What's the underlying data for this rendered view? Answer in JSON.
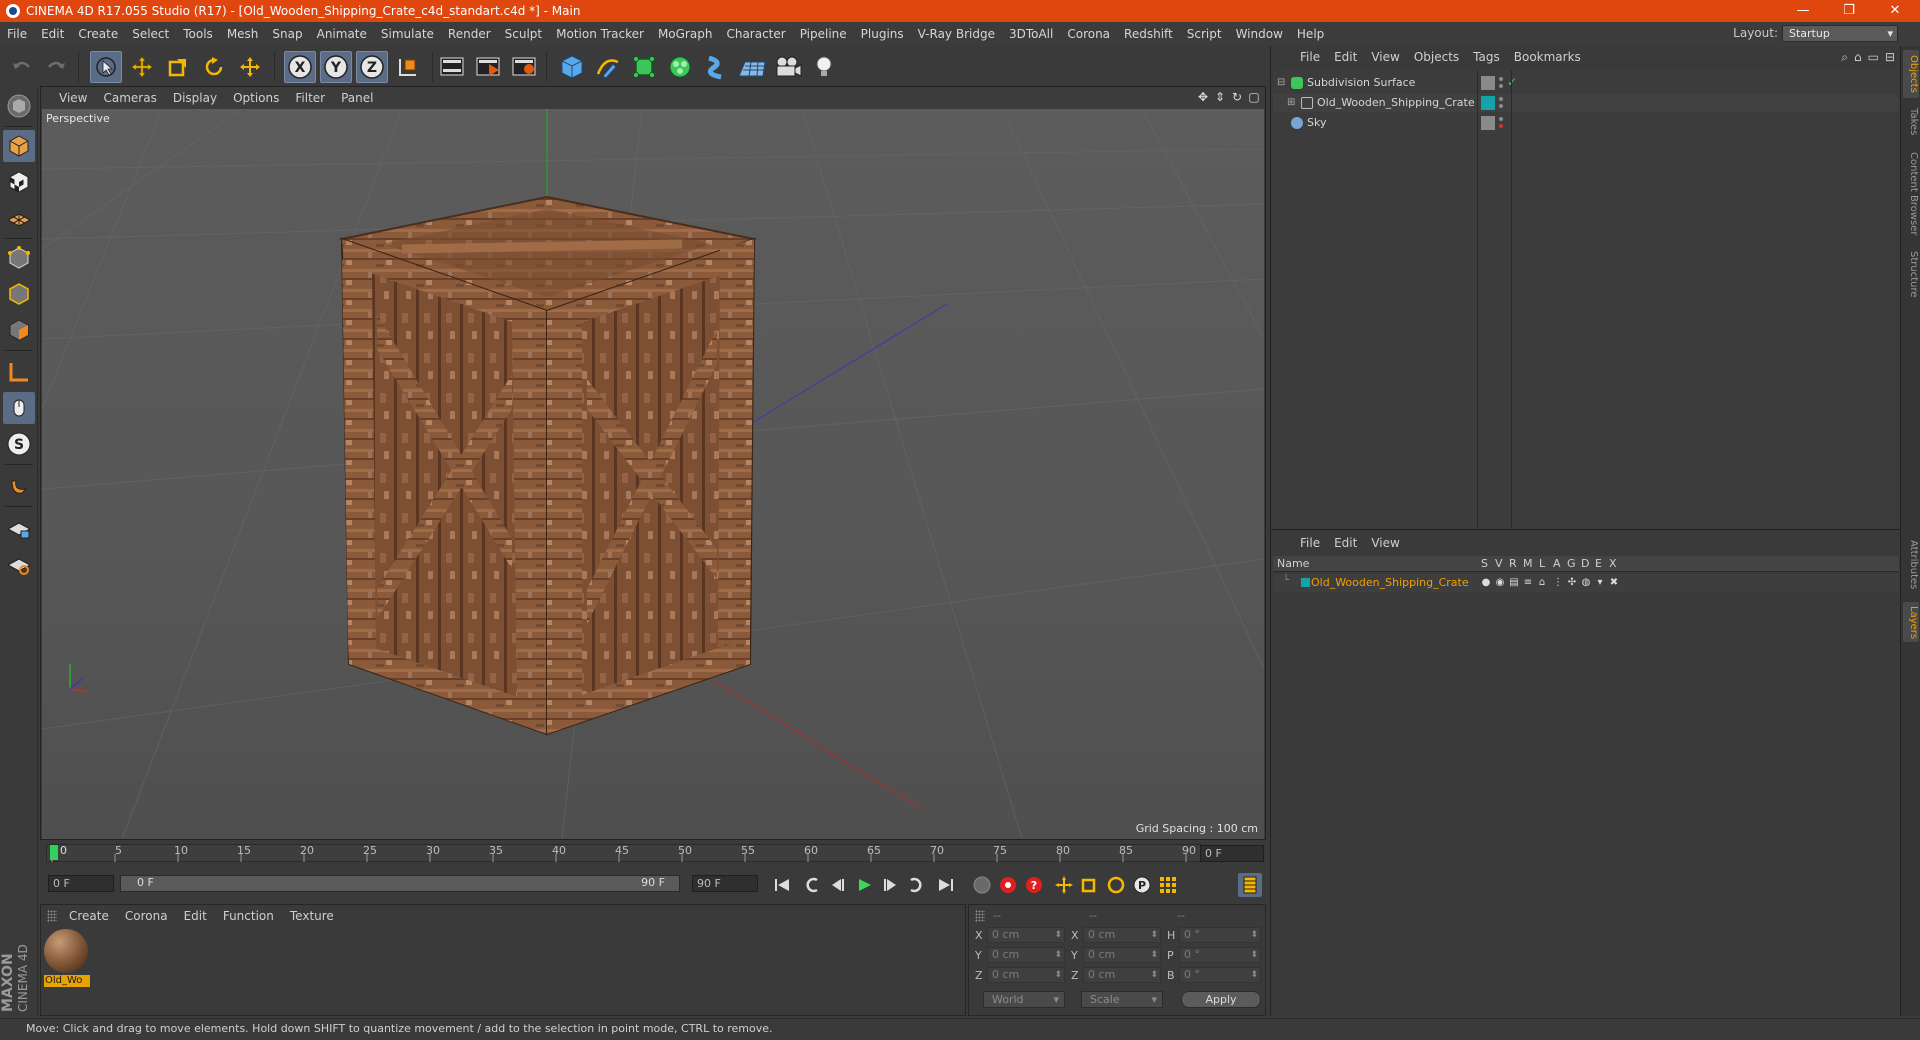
{
  "window": {
    "title": "CINEMA 4D R17.055 Studio (R17) - [Old_Wooden_Shipping_Crate_c4d_standart.c4d *] - Main",
    "minimize": "—",
    "maximize": "❐",
    "close": "✕"
  },
  "menubar": {
    "items": [
      "File",
      "Edit",
      "Create",
      "Select",
      "Tools",
      "Mesh",
      "Snap",
      "Animate",
      "Simulate",
      "Render",
      "Sculpt",
      "Motion Tracker",
      "MoGraph",
      "Character",
      "Pipeline",
      "Plugins",
      "V-Ray Bridge",
      "3DToAll",
      "Corona",
      "Redshift",
      "Script",
      "Window",
      "Help"
    ],
    "layout_label": "Layout:",
    "layout_value": "Startup"
  },
  "viewport": {
    "menu": [
      "View",
      "Cameras",
      "Display",
      "Options",
      "Filter",
      "Panel"
    ],
    "camera_label": "Perspective",
    "grid_spacing": "Grid Spacing : 100 cm"
  },
  "timeline": {
    "ticks": [
      "0",
      "5",
      "10",
      "15",
      "20",
      "25",
      "30",
      "35",
      "40",
      "45",
      "50",
      "55",
      "60",
      "65",
      "70",
      "75",
      "80",
      "85",
      "90"
    ],
    "current_frame": "0 F"
  },
  "transport": {
    "start_field": "0 F",
    "range_start": "0 F",
    "range_end": "90 F",
    "end_field": "90 F"
  },
  "material_manager": {
    "menu": [
      "Create",
      "Corona",
      "Edit",
      "Function",
      "Texture"
    ],
    "materials": [
      {
        "name": "Old_Wo"
      }
    ]
  },
  "coordinates": {
    "headers": [
      "--",
      "--",
      "--"
    ],
    "rows": [
      {
        "a1": "X",
        "v1": "0 cm",
        "a2": "X",
        "v2": "0 cm",
        "a3": "H",
        "v3": "0 °"
      },
      {
        "a1": "Y",
        "v1": "0 cm",
        "a2": "Y",
        "v2": "0 cm",
        "a3": "P",
        "v3": "0 °"
      },
      {
        "a1": "Z",
        "v1": "0 cm",
        "a2": "Z",
        "v2": "0 cm",
        "a3": "B",
        "v3": "0 °"
      }
    ],
    "space": "World",
    "mode": "Scale",
    "apply": "Apply"
  },
  "brand": {
    "line1": "MAXON",
    "line2": "CINEMA 4D"
  },
  "status": "Move: Click and drag to move elements. Hold down SHIFT to quantize movement / add to the selection in point mode, CTRL to remove.",
  "object_manager": {
    "menu": [
      "File",
      "Edit",
      "View",
      "Objects",
      "Tags",
      "Bookmarks"
    ],
    "objects": [
      {
        "name": "Subdivision Surface"
      },
      {
        "name": "Old_Wooden_Shipping_Crate"
      },
      {
        "name": "Sky"
      }
    ]
  },
  "layer_manager": {
    "menu": [
      "File",
      "Edit",
      "View"
    ],
    "columns": [
      "Name",
      "S",
      "V",
      "R",
      "M",
      "L",
      "A",
      "G",
      "D",
      "E",
      "X"
    ],
    "layers": [
      {
        "name": "Old_Wooden_Shipping_Crate",
        "color": "#13a3a8"
      }
    ]
  },
  "side_tabs": [
    "Objects",
    "Takes",
    "Content Browser",
    "Structure",
    "Attributes",
    "Layers"
  ],
  "colors": {
    "titlebar": "#e0470f",
    "accent": "#f2a000",
    "active_tool": "#5a6c86"
  }
}
